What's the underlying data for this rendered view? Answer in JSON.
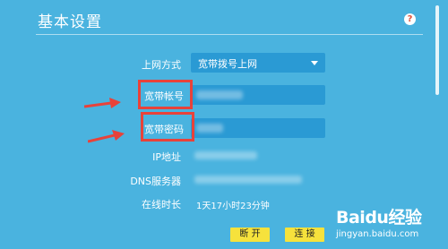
{
  "page": {
    "title": "基本设置",
    "help_symbol": "?"
  },
  "form": {
    "connection_type_label": "上网方式",
    "connection_type_value": "宽带拨号上网",
    "account_label": "宽带帐号",
    "password_label": "宽带密码",
    "ip_label": "IP地址",
    "dns_label": "DNS服务器",
    "online_time_label": "在线时长",
    "online_time_value": "1天17小时23分钟"
  },
  "buttons": {
    "disconnect": "断 开",
    "connect": "连 接"
  },
  "watermark": {
    "brand": "Baidu经验",
    "url": "jingyan.baidu.com"
  },
  "colors": {
    "background": "#4ab3df",
    "field": "#2a9ad4",
    "highlight": "#e8423a",
    "button": "#f6e23c"
  }
}
